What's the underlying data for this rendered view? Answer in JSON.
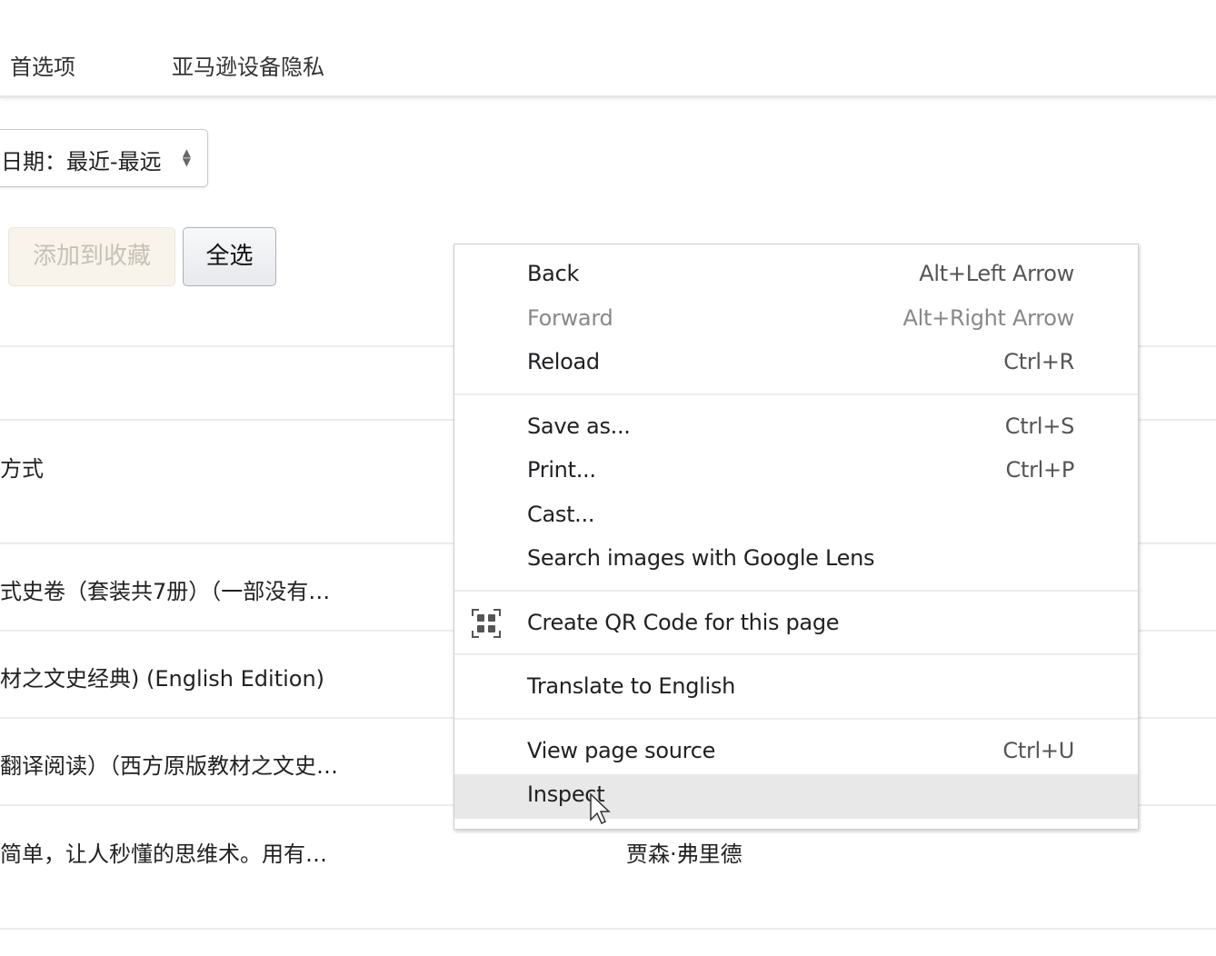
{
  "nav": {
    "items": [
      "首选项",
      "亚马逊设备隐私"
    ]
  },
  "sort": {
    "value": "日期：最近-最远"
  },
  "buttons": {
    "add_to_favorites": "添加到收藏",
    "select_all": "全选"
  },
  "rows": [
    "方式",
    "式史卷（套装共7册）（一部没有…",
    "材之文史经典) (English Edition)",
    "翻译阅读）（西方原版教材之文史…",
    "简单，让人秒懂的思维术。用有…"
  ],
  "author": "贾森·弗里德",
  "context_menu": {
    "items": [
      {
        "label": "Back",
        "shortcut": "Alt+Left Arrow"
      },
      {
        "label": "Forward",
        "shortcut": "Alt+Right Arrow",
        "disabled": true
      },
      {
        "label": "Reload",
        "shortcut": "Ctrl+R"
      },
      {
        "label": "Save as...",
        "shortcut": "Ctrl+S"
      },
      {
        "label": "Print...",
        "shortcut": "Ctrl+P"
      },
      {
        "label": "Cast..."
      },
      {
        "label": "Search images with Google Lens"
      },
      {
        "label": "Create QR Code for this page",
        "icon": "qr-code-icon"
      },
      {
        "label": "Translate to English"
      },
      {
        "label": "View page source",
        "shortcut": "Ctrl+U"
      },
      {
        "label": "Inspect",
        "highlighted": true
      }
    ]
  }
}
